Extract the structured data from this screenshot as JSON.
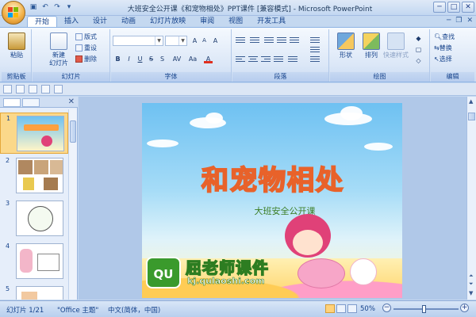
{
  "window": {
    "title": "大班安全公开课《和宠物相处》PPT课件 [兼容模式] - Microsoft PowerPoint",
    "controls": [
      "─",
      "□",
      "✕"
    ]
  },
  "quick_access": {
    "save_icon": "save-icon",
    "undo_icon": "undo-icon",
    "redo_icon": "redo-icon"
  },
  "tabs": [
    {
      "label": "开始",
      "active": true
    },
    {
      "label": "插入"
    },
    {
      "label": "设计"
    },
    {
      "label": "动画"
    },
    {
      "label": "幻灯片放映"
    },
    {
      "label": "审阅"
    },
    {
      "label": "视图"
    },
    {
      "label": "开发工具"
    }
  ],
  "ribbon": {
    "clipboard": {
      "label": "剪贴板",
      "paste": "粘贴"
    },
    "slides": {
      "label": "幻灯片",
      "new_slide": "新建\n幻灯片",
      "layout": "版式",
      "reset": "重设",
      "delete": "删除"
    },
    "font": {
      "label": "字体",
      "font_name": "",
      "font_size": "",
      "grow": "A",
      "shrink": "A",
      "clear": "A",
      "bold": "B",
      "italic": "I",
      "underline": "U",
      "strike": "S",
      "shadow": "S",
      "spacing": "AV",
      "case": "Aa",
      "color": "A"
    },
    "paragraph": {
      "label": "段落"
    },
    "drawing": {
      "label": "绘图",
      "shape": "形状",
      "arrange": "排列",
      "quick_styles": "快速样式"
    },
    "editing": {
      "label": "编辑",
      "find": "查找",
      "replace": "替换",
      "select": "选择"
    }
  },
  "slide": {
    "title": "和宠物相处",
    "subtitle": "大班安全公开课",
    "watermark_badge": "QU",
    "watermark_name": "屈老师课件",
    "watermark_url": "kj.qulaoshi.com"
  },
  "thumbnails": [
    {
      "num": "1",
      "selected": true
    },
    {
      "num": "2"
    },
    {
      "num": "3"
    },
    {
      "num": "4"
    },
    {
      "num": "5"
    }
  ],
  "status": {
    "slide_pos": "幻灯片 1/21",
    "theme": "\"Office 主题\"",
    "language": "中文(简体，中国)",
    "zoom": "50%",
    "zoom_level": 0.5
  },
  "colors": {
    "accent": "#15428b",
    "title_fill": "#ffa040",
    "title_stroke": "#e8622a",
    "subtitle": "#3b7d24",
    "selection": "#fbd88a"
  }
}
